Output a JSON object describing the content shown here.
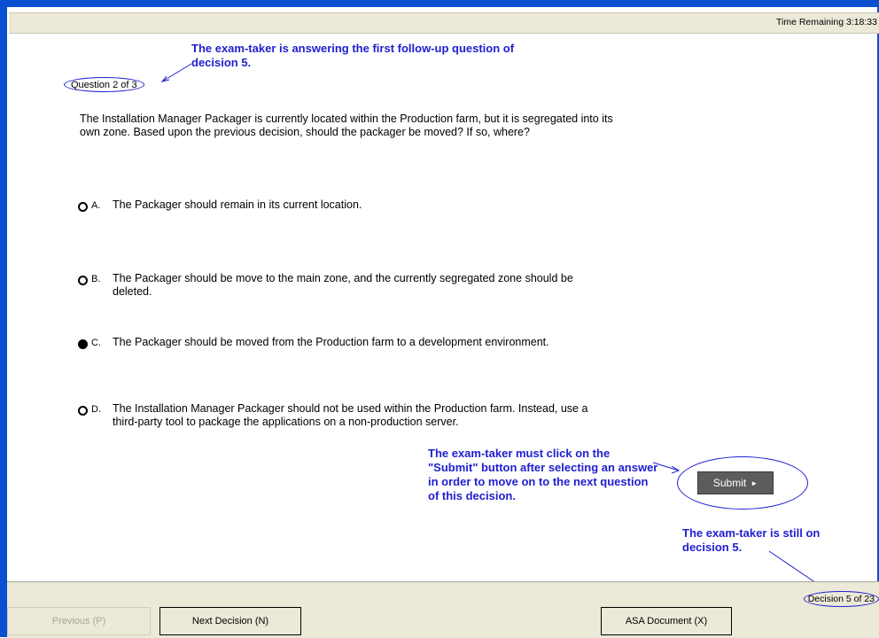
{
  "header": {
    "time_remaining": "Time Remaining 3:18:33"
  },
  "question": {
    "counter": "Question 2 of 3",
    "text": "The Installation Manager Packager is currently located within the Production farm, but it is segregated into its own zone. Based upon the previous decision, should the packager be moved? If so, where?",
    "options": [
      {
        "letter": "A.",
        "text": "The Packager should remain in its current location.",
        "selected": false
      },
      {
        "letter": "B.",
        "text": "The Packager should be move to the main zone, and the currently segregated zone should be deleted.",
        "selected": false
      },
      {
        "letter": "C.",
        "text": "The Packager should be moved from the Production farm to a development environment.",
        "selected": true
      },
      {
        "letter": "D.",
        "text": "The Installation Manager Packager should not be used within the Production farm. Instead, use a third-party tool to package the applications on a non-production server.",
        "selected": false
      }
    ]
  },
  "submit": {
    "label": "Submit",
    "arrow": "►"
  },
  "annotations": {
    "first": "The exam-taker is answering the first follow-up question of decision 5.",
    "second": "The exam-taker must click on the \"Submit\" button after selecting an answer in order to move on to the next question of this decision.",
    "third": "The exam-taker is still on decision 5.",
    "color": "#2020d0"
  },
  "footer": {
    "decision_counter": "Decision 5 of 23",
    "previous_label": "Previous (P)",
    "next_label": "Next Decision (N)",
    "asa_label": "ASA Document (X)"
  },
  "icons": {
    "radio_unselected": "radio-empty-icon",
    "radio_selected": "radio-filled-icon",
    "submit_arrow": "triangle-right-icon"
  }
}
